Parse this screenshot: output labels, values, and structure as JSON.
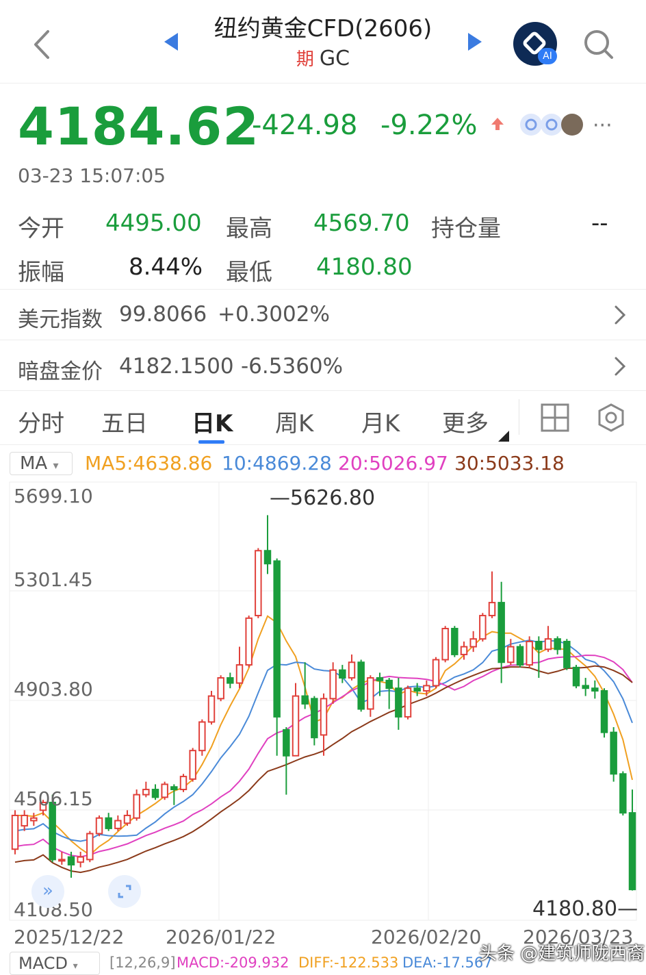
{
  "header": {
    "title": "纽约黄金CFD(2606)",
    "subtitle_tag": "期",
    "subtitle": "GC",
    "ai_label": "AI"
  },
  "quote": {
    "price": "4184.62",
    "change": "-424.98",
    "change_pct": "-9.22%",
    "time": "03-23 15:07:05",
    "more": "···"
  },
  "stats": {
    "open_label": "今开",
    "open": "4495.00",
    "high_label": "最高",
    "high": "4569.70",
    "oi_label": "持仓量",
    "oi": "--",
    "amp_label": "振幅",
    "amp": "8.44%",
    "low_label": "最低",
    "low": "4180.80"
  },
  "rows": [
    {
      "label": "美元指数",
      "value": "99.8066",
      "change": "+0.3002%"
    },
    {
      "label": "暗盘金价",
      "value": "4182.1500",
      "change": "-6.5360%"
    }
  ],
  "tabs": [
    "分时",
    "五日",
    "日K",
    "周K",
    "月K",
    "更多"
  ],
  "active_tab": "日K",
  "indicators": {
    "ma_selector": "MA",
    "ma5": "MA5:4638.86",
    "ma10": "10:4869.28",
    "ma20": "20:5026.97",
    "ma30": "30:5033.18"
  },
  "chart_labels": {
    "y_ticks": [
      "5699.10",
      "5301.45",
      "4903.80",
      "4506.15",
      "4108.50"
    ],
    "x_ticks": [
      "2025/12/22",
      "2026/01/22",
      "2026/02/20",
      "2026/03/23"
    ],
    "max_marker": "5626.80",
    "min_marker": "4180.80"
  },
  "macd": {
    "selector": "MACD",
    "params": "[12,26,9]",
    "macd": "MACD:-209.932",
    "diff": "DIFF:-122.533",
    "dea": "DEA:-17.567"
  },
  "watermark": "头条 @建筑师陇西裔",
  "colors": {
    "up": "#e0403a",
    "down": "#1a9d3c",
    "ma5": "#f0a020",
    "ma10": "#4a8ad8",
    "ma20": "#e040c0",
    "ma30": "#8b3a1a",
    "accent": "#2f7cf6"
  },
  "chart_data": {
    "type": "candlestick",
    "ylim": [
      4108.5,
      5699.1
    ],
    "candles": [
      {
        "o": 4340,
        "c": 4470,
        "h": 4490,
        "l": 4320
      },
      {
        "o": 4430,
        "c": 4470,
        "h": 4490,
        "l": 4410
      },
      {
        "o": 4450,
        "c": 4460,
        "h": 4480,
        "l": 4430
      },
      {
        "o": 4490,
        "c": 4520,
        "h": 4530,
        "l": 4470
      },
      {
        "o": 4520,
        "c": 4300,
        "h": 4550,
        "l": 4290
      },
      {
        "o": 4300,
        "c": 4300,
        "h": 4330,
        "l": 4280
      },
      {
        "o": 4310,
        "c": 4280,
        "h": 4330,
        "l": 4230
      },
      {
        "o": 4290,
        "c": 4310,
        "h": 4330,
        "l": 4270
      },
      {
        "o": 4300,
        "c": 4400,
        "h": 4410,
        "l": 4290
      },
      {
        "o": 4400,
        "c": 4460,
        "h": 4470,
        "l": 4390
      },
      {
        "o": 4460,
        "c": 4420,
        "h": 4480,
        "l": 4410
      },
      {
        "o": 4420,
        "c": 4450,
        "h": 4470,
        "l": 4410
      },
      {
        "o": 4440,
        "c": 4470,
        "h": 4490,
        "l": 4430
      },
      {
        "o": 4460,
        "c": 4550,
        "h": 4570,
        "l": 4450
      },
      {
        "o": 4550,
        "c": 4570,
        "h": 4600,
        "l": 4540
      },
      {
        "o": 4570,
        "c": 4540,
        "h": 4590,
        "l": 4530
      },
      {
        "o": 4540,
        "c": 4590,
        "h": 4600,
        "l": 4530
      },
      {
        "o": 4580,
        "c": 4570,
        "h": 4590,
        "l": 4510
      },
      {
        "o": 4570,
        "c": 4620,
        "h": 4630,
        "l": 4560
      },
      {
        "o": 4610,
        "c": 4720,
        "h": 4730,
        "l": 4600
      },
      {
        "o": 4720,
        "c": 4830,
        "h": 4840,
        "l": 4700
      },
      {
        "o": 4830,
        "c": 4930,
        "h": 4950,
        "l": 4820
      },
      {
        "o": 4920,
        "c": 5000,
        "h": 5010,
        "l": 4910
      },
      {
        "o": 5000,
        "c": 4980,
        "h": 5020,
        "l": 4960
      },
      {
        "o": 4980,
        "c": 5050,
        "h": 5120,
        "l": 4960
      },
      {
        "o": 5050,
        "c": 5230,
        "h": 5240,
        "l": 5040
      },
      {
        "o": 5240,
        "c": 5490,
        "h": 5500,
        "l": 5230
      },
      {
        "o": 5490,
        "c": 5440,
        "h": 5626.8,
        "l": 5400
      },
      {
        "o": 5450,
        "c": 4850,
        "h": 5460,
        "l": 4700
      },
      {
        "o": 4800,
        "c": 4700,
        "h": 4810,
        "l": 4550
      },
      {
        "o": 4700,
        "c": 4930,
        "h": 4980,
        "l": 4700
      },
      {
        "o": 4930,
        "c": 4900,
        "h": 5060,
        "l": 4880
      },
      {
        "o": 4920,
        "c": 4770,
        "h": 4930,
        "l": 4740
      },
      {
        "o": 4780,
        "c": 4920,
        "h": 4940,
        "l": 4700
      },
      {
        "o": 4920,
        "c": 5030,
        "h": 5060,
        "l": 4900
      },
      {
        "o": 5030,
        "c": 5000,
        "h": 5050,
        "l": 4980
      },
      {
        "o": 5000,
        "c": 5060,
        "h": 5090,
        "l": 4990
      },
      {
        "o": 5060,
        "c": 4880,
        "h": 5070,
        "l": 4870
      },
      {
        "o": 4880,
        "c": 5000,
        "h": 5010,
        "l": 4850
      },
      {
        "o": 5000,
        "c": 4990,
        "h": 5020,
        "l": 4930
      },
      {
        "o": 4990,
        "c": 4960,
        "h": 5000,
        "l": 4880
      },
      {
        "o": 4960,
        "c": 4850,
        "h": 5000,
        "l": 4800
      },
      {
        "o": 4850,
        "c": 4960,
        "h": 4970,
        "l": 4840
      },
      {
        "o": 4960,
        "c": 4950,
        "h": 4980,
        "l": 4930
      },
      {
        "o": 4950,
        "c": 4970,
        "h": 4990,
        "l": 4930
      },
      {
        "o": 4970,
        "c": 5070,
        "h": 5080,
        "l": 4960
      },
      {
        "o": 5070,
        "c": 5190,
        "h": 5200,
        "l": 5060
      },
      {
        "o": 5190,
        "c": 5090,
        "h": 5200,
        "l": 5080
      },
      {
        "o": 5090,
        "c": 5120,
        "h": 5140,
        "l": 5070
      },
      {
        "o": 5120,
        "c": 5150,
        "h": 5180,
        "l": 5100
      },
      {
        "o": 5150,
        "c": 5240,
        "h": 5250,
        "l": 5140
      },
      {
        "o": 5240,
        "c": 5290,
        "h": 5410,
        "l": 5230
      },
      {
        "o": 5290,
        "c": 5060,
        "h": 5370,
        "l": 4980
      },
      {
        "o": 5060,
        "c": 5120,
        "h": 5150,
        "l": 5050
      },
      {
        "o": 5120,
        "c": 5050,
        "h": 5130,
        "l": 5040
      },
      {
        "o": 5050,
        "c": 5140,
        "h": 5160,
        "l": 5040
      },
      {
        "o": 5140,
        "c": 5110,
        "h": 5160,
        "l": 5000
      },
      {
        "o": 5110,
        "c": 5150,
        "h": 5200,
        "l": 5100
      },
      {
        "o": 5150,
        "c": 5110,
        "h": 5160,
        "l": 5090
      },
      {
        "o": 5140,
        "c": 5040,
        "h": 5150,
        "l": 5030
      },
      {
        "o": 5040,
        "c": 4970,
        "h": 5050,
        "l": 4960
      },
      {
        "o": 4970,
        "c": 4960,
        "h": 5000,
        "l": 4930
      },
      {
        "o": 4960,
        "c": 4950,
        "h": 4990,
        "l": 4920
      },
      {
        "o": 4950,
        "c": 4790,
        "h": 4960,
        "l": 4770
      },
      {
        "o": 4790,
        "c": 4630,
        "h": 4810,
        "l": 4600
      },
      {
        "o": 4630,
        "c": 4480,
        "h": 4640,
        "l": 4470
      },
      {
        "o": 4480,
        "c": 4184.62,
        "h": 4569.7,
        "l": 4180.8
      }
    ]
  }
}
